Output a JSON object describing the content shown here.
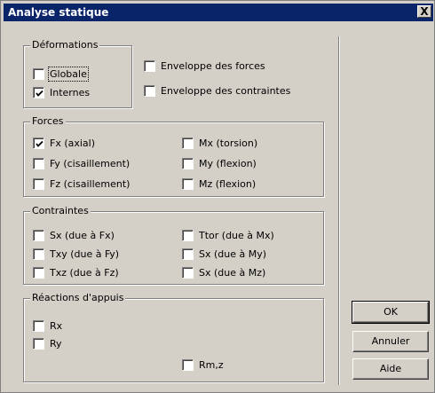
{
  "window": {
    "title": "Analyse statique",
    "close_label": "X"
  },
  "deformations": {
    "legend": "Déformations",
    "globale": {
      "label": "Globale",
      "checked": false
    },
    "internes": {
      "label": "Internes",
      "checked": true
    }
  },
  "enveloppes": {
    "forces": {
      "label": "Enveloppe des forces",
      "checked": false
    },
    "contraintes": {
      "label": "Enveloppe des contraintes",
      "checked": false
    }
  },
  "forces": {
    "legend": "Forces",
    "fx": {
      "label": "Fx (axial)",
      "checked": true
    },
    "fy": {
      "label": "Fy (cisaillement)",
      "checked": false
    },
    "fz": {
      "label": "Fz (cisaillement)",
      "checked": false
    },
    "mx": {
      "label": "Mx (torsion)",
      "checked": false
    },
    "my": {
      "label": "My (flexion)",
      "checked": false
    },
    "mz": {
      "label": "Mz (flexion)",
      "checked": false
    }
  },
  "contraintes": {
    "legend": "Contraintes",
    "sx_fx": {
      "label": "Sx (due à Fx)",
      "checked": false
    },
    "txy_fy": {
      "label": "Txy (due à Fy)",
      "checked": false
    },
    "txz_fz": {
      "label": "Txz (due à Fz)",
      "checked": false
    },
    "ttor_mx": {
      "label": "Ttor (due à Mx)",
      "checked": false
    },
    "sx_my": {
      "label": "Sx (due à My)",
      "checked": false
    },
    "sx_mz": {
      "label": "Sx (due à Mz)",
      "checked": false
    }
  },
  "reactions": {
    "legend": "Réactions d'appuis",
    "rx": {
      "label": "Rx",
      "checked": false
    },
    "ry": {
      "label": "Ry",
      "checked": false
    },
    "rmz": {
      "label": "Rm,z",
      "checked": false
    }
  },
  "buttons": {
    "ok": "OK",
    "annuler": "Annuler",
    "aide": "Aide"
  }
}
